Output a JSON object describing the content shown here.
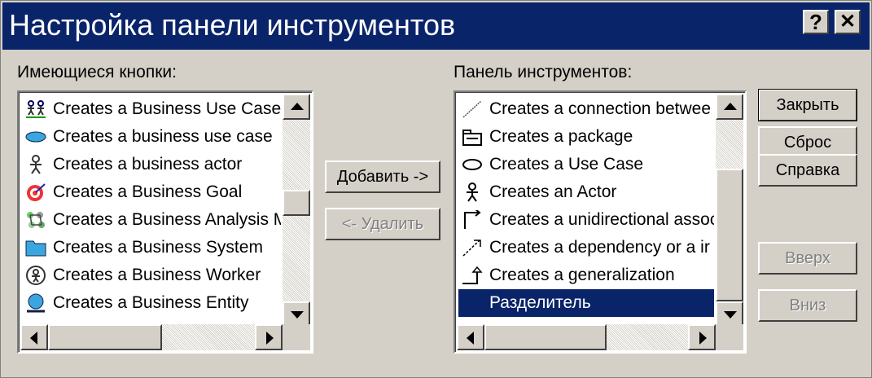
{
  "window": {
    "title": "Настройка панели инструментов",
    "help_glyph": "?",
    "close_glyph": "✕"
  },
  "available": {
    "label": "Имеющиеся кнопки:",
    "items": [
      {
        "label": "Creates a Business Use Case",
        "icon": "business-use-case-icon"
      },
      {
        "label": "Creates a business use case",
        "icon": "blue-ellipse-icon"
      },
      {
        "label": "Creates a business actor",
        "icon": "business-actor-icon"
      },
      {
        "label": "Creates a Business Goal",
        "icon": "business-goal-icon"
      },
      {
        "label": "Creates a Business Analysis M",
        "icon": "business-analysis-icon"
      },
      {
        "label": "Creates a Business System",
        "icon": "folder-icon"
      },
      {
        "label": "Creates a Business Worker",
        "icon": "business-worker-icon"
      },
      {
        "label": "Creates a Business Entity",
        "icon": "business-entity-icon"
      }
    ]
  },
  "toolbar": {
    "label": "Панель инструментов:",
    "items": [
      {
        "label": "Creates a connection betwee",
        "icon": "connection-line-icon"
      },
      {
        "label": "Creates a package",
        "icon": "package-icon"
      },
      {
        "label": "Creates a Use Case",
        "icon": "use-case-ellipse-icon"
      },
      {
        "label": "Creates an Actor",
        "icon": "actor-icon"
      },
      {
        "label": "Creates a unidirectional assoc",
        "icon": "unidirectional-association-icon"
      },
      {
        "label": "Creates a dependency or a ir",
        "icon": "dependency-arrow-icon"
      },
      {
        "label": "Creates a generalization",
        "icon": "generalization-icon"
      },
      {
        "label": "Разделитель",
        "icon": "",
        "selected": true
      }
    ]
  },
  "buttons": {
    "add": "Добавить ->",
    "remove": "<- Удалить",
    "close": "Закрыть",
    "reset": "Сброс",
    "help": "Справка",
    "up": "Вверх",
    "down": "Вниз"
  },
  "colors": {
    "titlebar": "#0a246a",
    "face": "#d4d0c8",
    "selection": "#0a246a"
  }
}
